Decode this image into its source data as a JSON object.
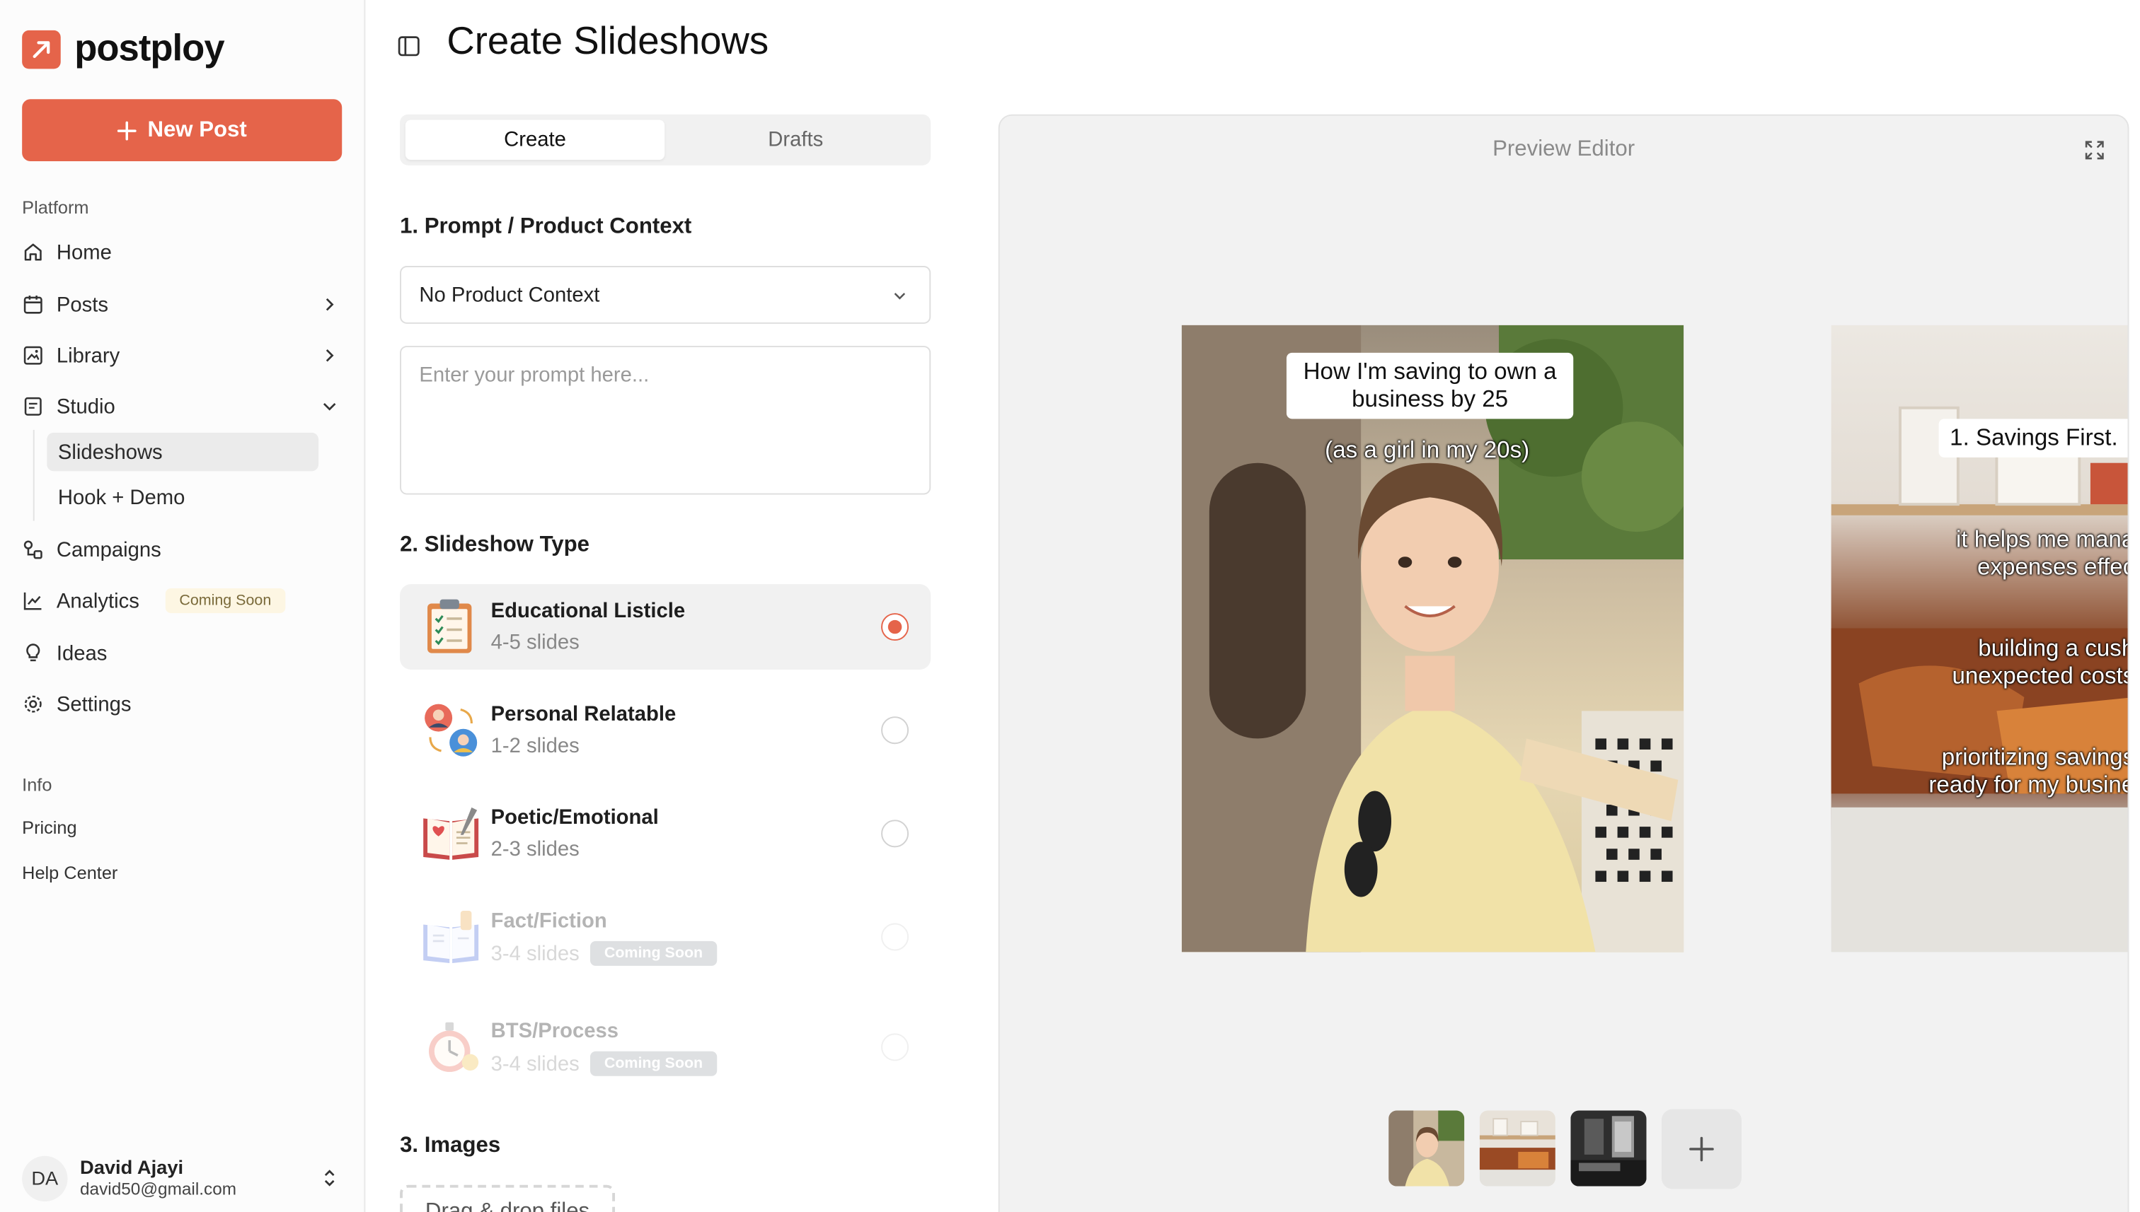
{
  "app": {
    "name": "postploy",
    "brand_color": "#e5644a"
  },
  "sidebar": {
    "new_post_label": "New Post",
    "platform_label": "Platform",
    "items": [
      {
        "label": "Home"
      },
      {
        "label": "Posts"
      },
      {
        "label": "Library"
      },
      {
        "label": "Studio"
      },
      {
        "label": "Campaigns"
      },
      {
        "label": "Analytics",
        "badge": "Coming Soon"
      },
      {
        "label": "Ideas"
      },
      {
        "label": "Settings"
      }
    ],
    "studio_sub": [
      {
        "label": "Slideshows"
      },
      {
        "label": "Hook + Demo"
      }
    ],
    "info_label": "Info",
    "info_links": [
      {
        "label": "Pricing"
      },
      {
        "label": "Help Center"
      }
    ],
    "user": {
      "initials": "DA",
      "name": "David Ajayi",
      "email": "david50@gmail.com"
    }
  },
  "header": {
    "title": "Create Slideshows"
  },
  "form": {
    "tabs": [
      {
        "label": "Create"
      },
      {
        "label": "Drafts"
      }
    ],
    "step1_title": "1. Prompt / Product Context",
    "context_select": "No Product Context",
    "prompt_placeholder": "Enter your prompt here...",
    "step2_title": "2. Slideshow Type",
    "types": [
      {
        "name": "Educational Listicle",
        "slides": "4-5 slides",
        "selected": true
      },
      {
        "name": "Personal Relatable",
        "slides": "1-2 slides"
      },
      {
        "name": "Poetic/Emotional",
        "slides": "2-3 slides"
      },
      {
        "name": "Fact/Fiction",
        "slides": "3-4 slides",
        "badge": "Coming Soon"
      },
      {
        "name": "BTS/Process",
        "slides": "3-4 slides",
        "badge": "Coming Soon"
      }
    ],
    "step3_title": "3. Images",
    "dropzone_label": "Drag & drop files"
  },
  "preview": {
    "title": "Preview Editor",
    "slide1": {
      "caption": "How I'm saving to own a business by 25",
      "subcaption": "(as a girl in my 20s)"
    },
    "slide2": {
      "caption": "1. Savings First.",
      "lines": [
        "it helps me mana",
        "expenses effec",
        "building a cush",
        "unexpected costs",
        "prioritizing savings",
        "ready for my busine"
      ]
    }
  }
}
